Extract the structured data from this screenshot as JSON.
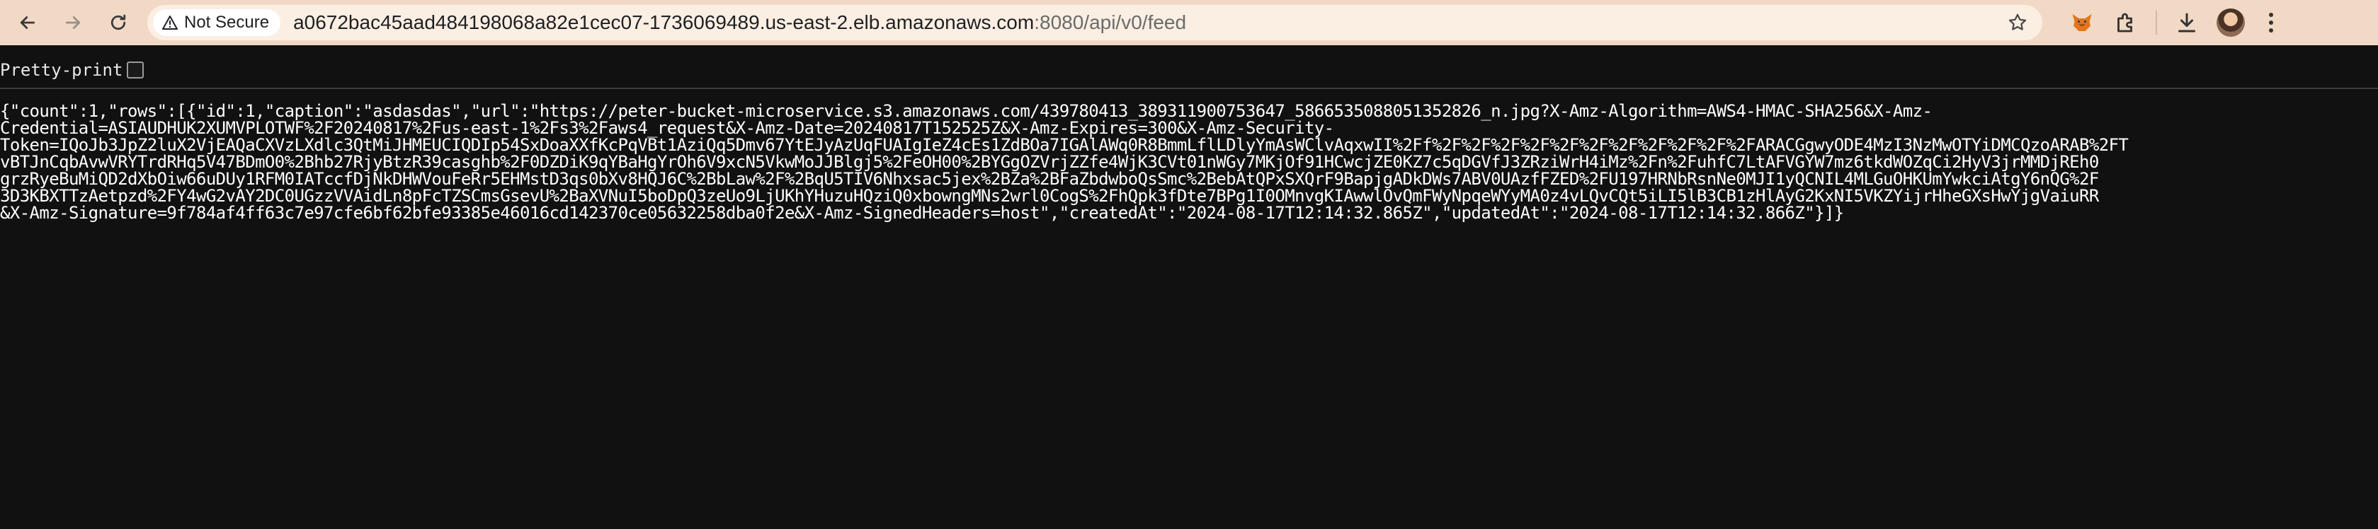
{
  "browser": {
    "security_label": "Not Secure",
    "url_host": "a0672bac45aad484198068a82e1cec07-1736069489.us-east-2.elb.amazonaws.com",
    "url_path": ":8080/api/v0/feed"
  },
  "page": {
    "pretty_print_label": "Pretty-print",
    "pretty_print_checked": false,
    "json_lines": [
      "{\"count\":1,\"rows\":[{\"id\":1,\"caption\":\"asdasdas\",\"url\":\"https://peter-bucket-microservice.s3.amazonaws.com/439780413_389311900753647_5866535088051352826_n.jpg?X-Amz-Algorithm=AWS4-HMAC-SHA256&X-Amz-",
      "Credential=ASIAUDHUK2XUMVPLOTWF%2F20240817%2Fus-east-1%2Fs3%2Faws4_request&X-Amz-Date=20240817T152525Z&X-Amz-Expires=300&X-Amz-Security-",
      "Token=IQoJb3JpZ2luX2VjEAQaCXVzLXdlc3QtMiJHMEUCIQDIp54SxDoaXXfKcPqVBt1AziQq5Dmv67YtEJyAzUqFUAIgIeZ4cEs1ZdBOa7IGAlAWq0R8BmmLflLDlyYmAsWClvAqxwII%2Ff%2F%2F%2F%2F%2F%2F%2F%2F%2F%2F%2FARACGgwyODE4MzI3NzMwOTYiDMCQzoARAB%2FT",
      "vBTJnCqbAvwVRYTrdRHq5V47BDmO0%2Bhb27RjyBtzR39casghb%2F0DZDiK9qYBaHgYrOh6V9xcN5VkwMoJJBlgj5%2FeOH00%2BYGgOZVrjZZfe4WjK3CVt01nWGy7MKjOf91HCwcjZE0KZ7c5qDGVfJ3ZRziWrH4iMz%2Fn%2FuhfC7LtAFVGYW7mz6tkdWOZqCi2HyV3jrMMDjREh0",
      "grzRyeBuMiQD2dXbOiw66uDUy1RFM0IATccfDjNkDHWVouFeRr5EHMstD3qs0bXv8HQJ6C%2BbLaw%2F%2BqU5TIV6Nhxsac5jex%2BZa%2BFaZbdwboQsSmc%2BebAtQPxSXQrF9BapjgADkDWs7ABV0UAzfFZED%2FU197HRNbRsnNe0MJI1yQCNIL4MLGuOHKUmYwkciAtgY6nQG%2F",
      "3D3KBXTTzAetpzd%2FY4wG2vAY2DC0UGzzVVAidLn8pFcTZSCmsGsevU%2BaXVNuI5boDpQ3zeUo9LjUKhYHuzuHQziQ0xbowngMNs2wrl0CogS%2FhQpk3fDte7BPg1I0OMnvgKIAwwlOvQmFWyNpqeWYyMA0z4vLQvCQt5iLI5lB3CB1zHlAyG2KxNI5VKZYijrHheGXsHwYjgVaiuRR",
      "&X-Amz-Signature=9f784af4ff63c7e97cfe6bf62bfe93385e46016cd142370ce05632258dba0f2e&X-Amz-SignedHeaders=host\",\"createdAt\":\"2024-08-17T12:14:32.865Z\",\"updatedAt\":\"2024-08-17T12:14:32.866Z\"}]}"
    ]
  }
}
